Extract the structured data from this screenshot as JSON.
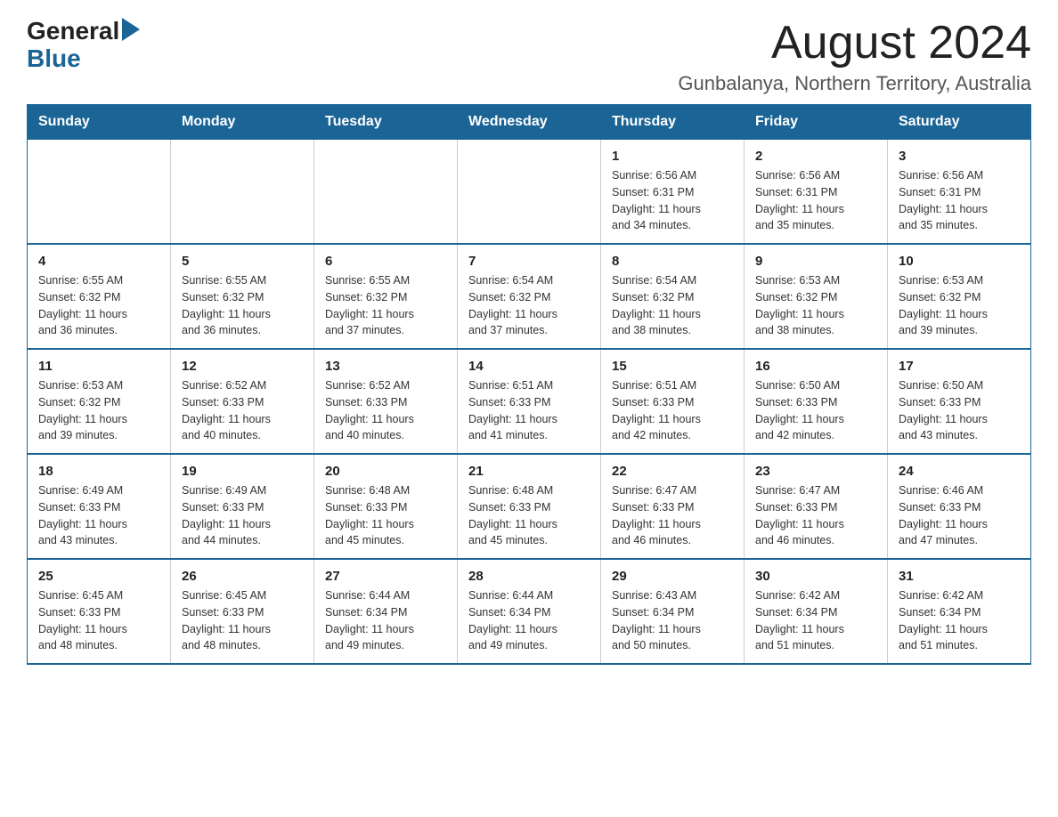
{
  "logo": {
    "general": "General",
    "blue": "Blue",
    "arrow": "▶"
  },
  "header": {
    "month": "August 2024",
    "location": "Gunbalanya, Northern Territory, Australia"
  },
  "days_of_week": [
    "Sunday",
    "Monday",
    "Tuesday",
    "Wednesday",
    "Thursday",
    "Friday",
    "Saturday"
  ],
  "weeks": [
    [
      {
        "day": "",
        "info": ""
      },
      {
        "day": "",
        "info": ""
      },
      {
        "day": "",
        "info": ""
      },
      {
        "day": "",
        "info": ""
      },
      {
        "day": "1",
        "info": "Sunrise: 6:56 AM\nSunset: 6:31 PM\nDaylight: 11 hours\nand 34 minutes."
      },
      {
        "day": "2",
        "info": "Sunrise: 6:56 AM\nSunset: 6:31 PM\nDaylight: 11 hours\nand 35 minutes."
      },
      {
        "day": "3",
        "info": "Sunrise: 6:56 AM\nSunset: 6:31 PM\nDaylight: 11 hours\nand 35 minutes."
      }
    ],
    [
      {
        "day": "4",
        "info": "Sunrise: 6:55 AM\nSunset: 6:32 PM\nDaylight: 11 hours\nand 36 minutes."
      },
      {
        "day": "5",
        "info": "Sunrise: 6:55 AM\nSunset: 6:32 PM\nDaylight: 11 hours\nand 36 minutes."
      },
      {
        "day": "6",
        "info": "Sunrise: 6:55 AM\nSunset: 6:32 PM\nDaylight: 11 hours\nand 37 minutes."
      },
      {
        "day": "7",
        "info": "Sunrise: 6:54 AM\nSunset: 6:32 PM\nDaylight: 11 hours\nand 37 minutes."
      },
      {
        "day": "8",
        "info": "Sunrise: 6:54 AM\nSunset: 6:32 PM\nDaylight: 11 hours\nand 38 minutes."
      },
      {
        "day": "9",
        "info": "Sunrise: 6:53 AM\nSunset: 6:32 PM\nDaylight: 11 hours\nand 38 minutes."
      },
      {
        "day": "10",
        "info": "Sunrise: 6:53 AM\nSunset: 6:32 PM\nDaylight: 11 hours\nand 39 minutes."
      }
    ],
    [
      {
        "day": "11",
        "info": "Sunrise: 6:53 AM\nSunset: 6:32 PM\nDaylight: 11 hours\nand 39 minutes."
      },
      {
        "day": "12",
        "info": "Sunrise: 6:52 AM\nSunset: 6:33 PM\nDaylight: 11 hours\nand 40 minutes."
      },
      {
        "day": "13",
        "info": "Sunrise: 6:52 AM\nSunset: 6:33 PM\nDaylight: 11 hours\nand 40 minutes."
      },
      {
        "day": "14",
        "info": "Sunrise: 6:51 AM\nSunset: 6:33 PM\nDaylight: 11 hours\nand 41 minutes."
      },
      {
        "day": "15",
        "info": "Sunrise: 6:51 AM\nSunset: 6:33 PM\nDaylight: 11 hours\nand 42 minutes."
      },
      {
        "day": "16",
        "info": "Sunrise: 6:50 AM\nSunset: 6:33 PM\nDaylight: 11 hours\nand 42 minutes."
      },
      {
        "day": "17",
        "info": "Sunrise: 6:50 AM\nSunset: 6:33 PM\nDaylight: 11 hours\nand 43 minutes."
      }
    ],
    [
      {
        "day": "18",
        "info": "Sunrise: 6:49 AM\nSunset: 6:33 PM\nDaylight: 11 hours\nand 43 minutes."
      },
      {
        "day": "19",
        "info": "Sunrise: 6:49 AM\nSunset: 6:33 PM\nDaylight: 11 hours\nand 44 minutes."
      },
      {
        "day": "20",
        "info": "Sunrise: 6:48 AM\nSunset: 6:33 PM\nDaylight: 11 hours\nand 45 minutes."
      },
      {
        "day": "21",
        "info": "Sunrise: 6:48 AM\nSunset: 6:33 PM\nDaylight: 11 hours\nand 45 minutes."
      },
      {
        "day": "22",
        "info": "Sunrise: 6:47 AM\nSunset: 6:33 PM\nDaylight: 11 hours\nand 46 minutes."
      },
      {
        "day": "23",
        "info": "Sunrise: 6:47 AM\nSunset: 6:33 PM\nDaylight: 11 hours\nand 46 minutes."
      },
      {
        "day": "24",
        "info": "Sunrise: 6:46 AM\nSunset: 6:33 PM\nDaylight: 11 hours\nand 47 minutes."
      }
    ],
    [
      {
        "day": "25",
        "info": "Sunrise: 6:45 AM\nSunset: 6:33 PM\nDaylight: 11 hours\nand 48 minutes."
      },
      {
        "day": "26",
        "info": "Sunrise: 6:45 AM\nSunset: 6:33 PM\nDaylight: 11 hours\nand 48 minutes."
      },
      {
        "day": "27",
        "info": "Sunrise: 6:44 AM\nSunset: 6:34 PM\nDaylight: 11 hours\nand 49 minutes."
      },
      {
        "day": "28",
        "info": "Sunrise: 6:44 AM\nSunset: 6:34 PM\nDaylight: 11 hours\nand 49 minutes."
      },
      {
        "day": "29",
        "info": "Sunrise: 6:43 AM\nSunset: 6:34 PM\nDaylight: 11 hours\nand 50 minutes."
      },
      {
        "day": "30",
        "info": "Sunrise: 6:42 AM\nSunset: 6:34 PM\nDaylight: 11 hours\nand 51 minutes."
      },
      {
        "day": "31",
        "info": "Sunrise: 6:42 AM\nSunset: 6:34 PM\nDaylight: 11 hours\nand 51 minutes."
      }
    ]
  ]
}
